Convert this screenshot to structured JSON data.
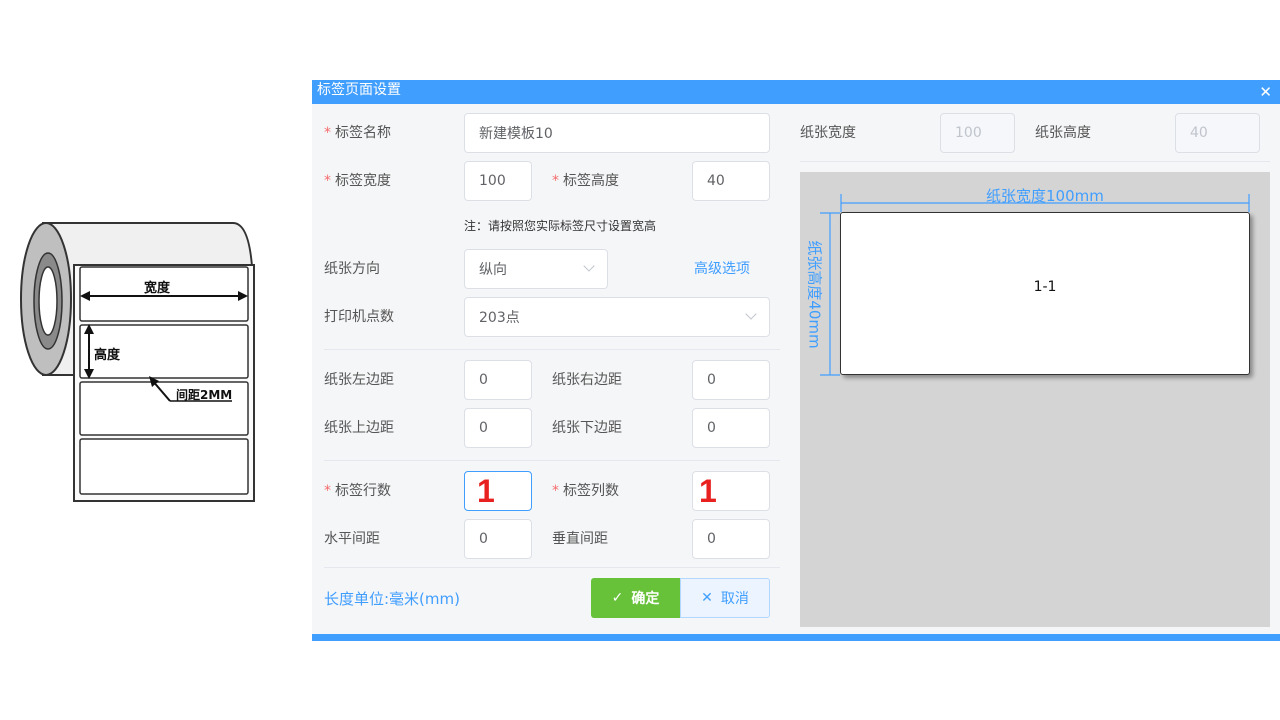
{
  "illustration": {
    "width_label": "宽度",
    "height_label": "高度",
    "gap_label": "间距2MM"
  },
  "dialog": {
    "title": "标签页面设置",
    "close_icon": "close-icon",
    "fields": {
      "label_name": {
        "label": "标签名称",
        "value": "新建模板10",
        "required": true
      },
      "label_width": {
        "label": "标签宽度",
        "value": "100",
        "required": true
      },
      "label_height": {
        "label": "标签高度",
        "value": "40",
        "required": true
      },
      "note": "注：请按照您实际标签尺寸设置宽高",
      "paper_direction": {
        "label": "纸张方向",
        "value": "纵向"
      },
      "advanced_options": "高级选项",
      "printer_dpi": {
        "label": "打印机点数",
        "value": "203点"
      },
      "paper_left_margin": {
        "label": "纸张左边距",
        "value": "0"
      },
      "paper_right_margin": {
        "label": "纸张右边距",
        "value": "0"
      },
      "paper_top_margin": {
        "label": "纸张上边距",
        "value": "0"
      },
      "paper_bottom_margin": {
        "label": "纸张下边距",
        "value": "0"
      },
      "label_rows": {
        "label": "标签行数",
        "value": "1",
        "required": true
      },
      "label_cols": {
        "label": "标签列数",
        "value": "1",
        "required": true
      },
      "horizontal_gap": {
        "label": "水平间距",
        "value": "0"
      },
      "vertical_gap": {
        "label": "垂直间距",
        "value": "0"
      }
    },
    "unit_text": "长度单位:毫米(mm)",
    "confirm_label": "确定",
    "cancel_label": "取消",
    "paper": {
      "width_label": "纸张宽度",
      "width_value": "100",
      "height_label": "纸张高度",
      "height_value": "40"
    },
    "preview": {
      "width_dim": "纸张宽度100mm",
      "height_dim": "纸张高度40mm",
      "cell_label": "1-1"
    }
  },
  "colors": {
    "primary": "#409eff",
    "success": "#67c23a",
    "required": "#f56c6c",
    "annotation_red": "#e82020"
  }
}
